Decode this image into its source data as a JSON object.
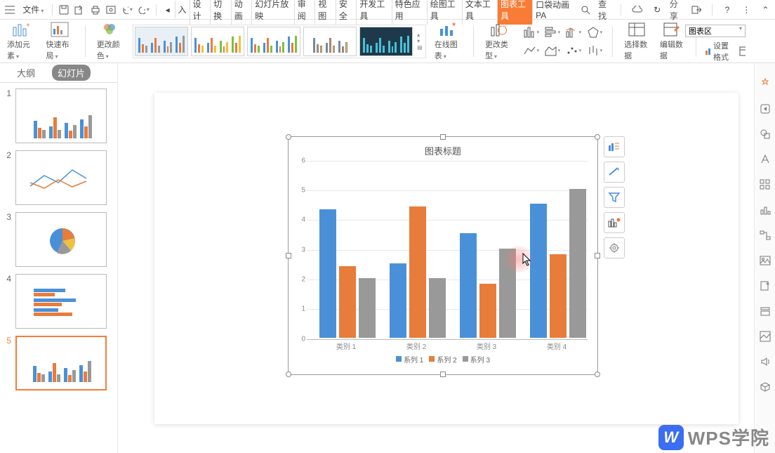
{
  "menu": {
    "file": "文件",
    "tabs": [
      "入",
      "设计",
      "切换",
      "动画",
      "幻灯片放映",
      "审阅",
      "视图",
      "安全",
      "开发工具",
      "特色应用",
      "绘图工具",
      "文本工具",
      "图表工具",
      "口袋动画 PA"
    ],
    "active_tab_index": 12,
    "search": "查找",
    "share": "分享"
  },
  "ribbon": {
    "add_element": "添加元素",
    "quick_layout": "快速布局",
    "change_color": "更改颜色",
    "online_chart": "在线图表",
    "change_type": "更改类型",
    "select_data": "选择数据",
    "edit_data": "编辑数据",
    "chart_area_label": "图表区",
    "set_format": "设置格式"
  },
  "sidebar": {
    "outline": "大纲",
    "slides": "幻灯片",
    "slide_nums": [
      "1",
      "2",
      "3",
      "4",
      "5"
    ],
    "active_index": 4
  },
  "chart": {
    "title": "图表标题",
    "legend": [
      "系列 1",
      "系列 2",
      "系列 3"
    ],
    "x_labels": [
      "类别 1",
      "类别 2",
      "类别 3",
      "类别 4"
    ],
    "y_ticks": [
      "0",
      "1",
      "2",
      "3",
      "4",
      "5",
      "6"
    ]
  },
  "chart_data": {
    "type": "bar",
    "title": "图表标题",
    "categories": [
      "类别 1",
      "类别 2",
      "类别 3",
      "类别 4"
    ],
    "series": [
      {
        "name": "系列 1",
        "values": [
          4.3,
          2.5,
          3.5,
          4.5
        ],
        "color": "#4a90d9"
      },
      {
        "name": "系列 2",
        "values": [
          2.4,
          4.4,
          1.8,
          2.8
        ],
        "color": "#e87c3a"
      },
      {
        "name": "系列 3",
        "values": [
          2.0,
          2.0,
          3.0,
          5.0
        ],
        "color": "#999999"
      }
    ],
    "ylim": [
      0,
      6
    ],
    "xlabel": "",
    "ylabel": ""
  },
  "watermark": {
    "text": "WPS学院",
    "logo": "W"
  },
  "colors": {
    "s1": "#4a90d9",
    "s2": "#e87c3a",
    "s3": "#999999",
    "accent": "#f87c36"
  }
}
